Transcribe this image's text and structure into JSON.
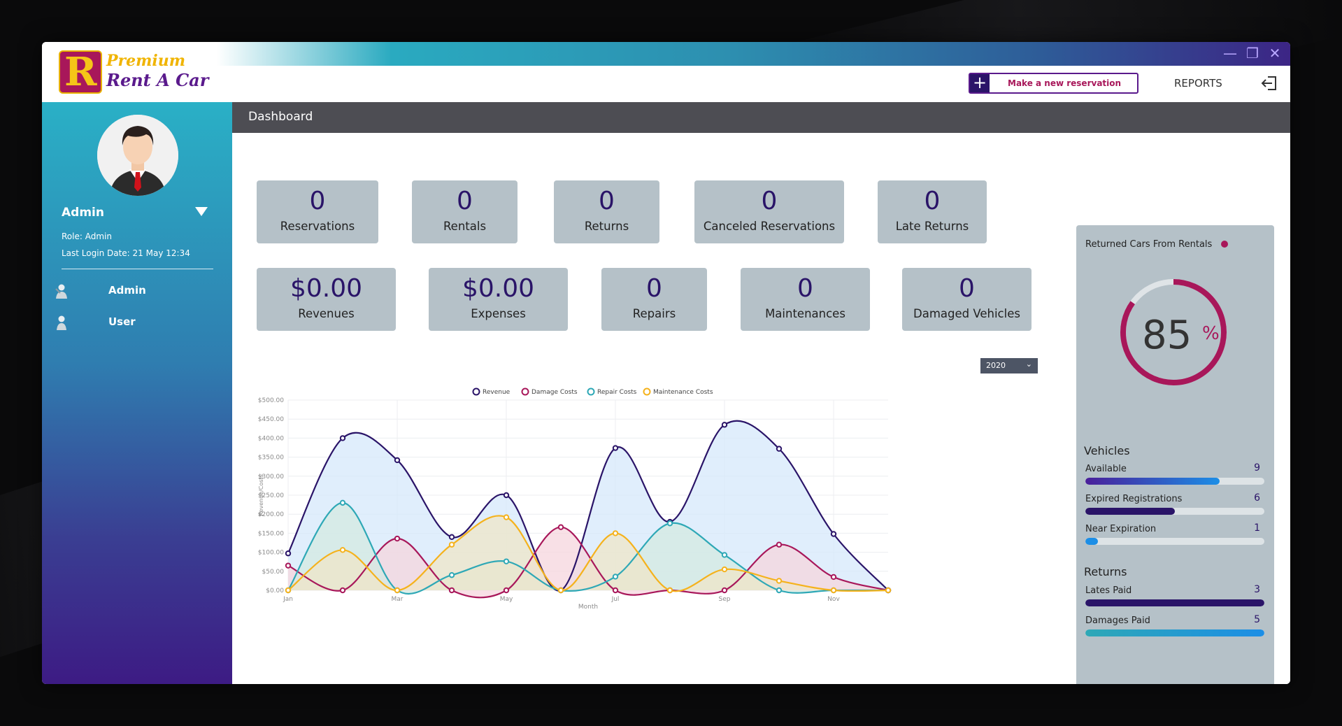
{
  "app": {
    "logo_line1": "Premium",
    "logo_line2": "Rent A Car",
    "logo_letter": "R",
    "new_reservation_label": "Make a new reservation",
    "reports_label": "REPORTS"
  },
  "window_controls": {
    "minimize": "—",
    "maximize": "❐",
    "close": "✕"
  },
  "sidebar": {
    "user_name": "Admin",
    "role": "Role: Admin",
    "last_login": "Last Login Date: 21 May 12:34",
    "items": [
      {
        "label": "Admin",
        "icon": "admin-user-icon"
      },
      {
        "label": "User",
        "icon": "user-icon"
      }
    ]
  },
  "header": {
    "title": "Dashboard"
  },
  "stats": {
    "row1": [
      {
        "value": "0",
        "label": "Reservations"
      },
      {
        "value": "0",
        "label": "Rentals"
      },
      {
        "value": "0",
        "label": "Returns"
      },
      {
        "value": "0",
        "label": "Canceled Reservations"
      },
      {
        "value": "0",
        "label": "Late Returns"
      }
    ],
    "row2": [
      {
        "value": "$0.00",
        "label": "Revenues"
      },
      {
        "value": "$0.00",
        "label": "Expenses"
      },
      {
        "value": "0",
        "label": "Repairs"
      },
      {
        "value": "0",
        "label": "Maintenances"
      },
      {
        "value": "0",
        "label": "Damaged Vehicles"
      }
    ]
  },
  "year_select": {
    "value": "2020"
  },
  "chart_data": {
    "type": "area",
    "x": [
      "Jan",
      "Feb",
      "Mar",
      "Apr",
      "May",
      "Jun",
      "Jul",
      "Aug",
      "Sep",
      "Oct",
      "Nov",
      "Dec"
    ],
    "x_tick_labels": [
      "Jan",
      "Mar",
      "May",
      "Jul",
      "Sep",
      "Nov"
    ],
    "y_tick_labels": [
      "$0.00",
      "$50.00",
      "$100.00",
      "$150.00",
      "$200.00",
      "$250.00",
      "$300.00",
      "$350.00",
      "$400.00",
      "$450.00",
      "$500.00"
    ],
    "xlabel": "Month",
    "ylabel": "Revenue/Costs",
    "ylim": [
      0,
      500
    ],
    "legend_position": "top",
    "grid": true,
    "smooth": true,
    "series": [
      {
        "name": "Revenue",
        "color": "#2a1468",
        "fill": "#d6e8fb",
        "values": [
          97,
          400,
          342,
          140,
          250,
          0,
          374,
          180,
          435,
          372,
          148,
          0
        ]
      },
      {
        "name": "Damage Costs",
        "color": "#a8175a",
        "fill": "#f5d5de",
        "values": [
          65,
          0,
          136,
          0,
          0,
          166,
          0,
          0,
          0,
          120,
          35,
          0
        ]
      },
      {
        "name": "Repair Costs",
        "color": "#2ea8b6",
        "fill": "#d4e9e2",
        "values": [
          0,
          230,
          0,
          40,
          76,
          0,
          36,
          176,
          93,
          0,
          0,
          0
        ]
      },
      {
        "name": "Maintenance Costs",
        "color": "#f5b21c",
        "fill": "#efe5c8",
        "values": [
          0,
          106,
          0,
          120,
          192,
          0,
          150,
          0,
          55,
          25,
          0,
          0
        ]
      }
    ]
  },
  "panel": {
    "title": "Returned Cars From Rentals",
    "gauge_value": "85",
    "gauge_fraction": 0.85,
    "gauge_unit": "%",
    "vehicles_title": "Vehicles",
    "vehicles": [
      {
        "label": "Available",
        "value": "9",
        "fraction": 0.75,
        "colors": [
          "#4a1f9a",
          "#1c8ee6"
        ]
      },
      {
        "label": "Expired Registrations",
        "value": "6",
        "fraction": 0.5,
        "colors": [
          "#2a1468",
          "#2a1468"
        ]
      },
      {
        "label": "Near Expiration",
        "value": "1",
        "fraction": 0.07,
        "colors": [
          "#1c8ee6",
          "#1c8ee6"
        ]
      }
    ],
    "returns_title": "Returns",
    "returns": [
      {
        "label": "Lates Paid",
        "value": "3",
        "fraction": 1.0,
        "colors": [
          "#2a1468",
          "#2a1468"
        ]
      },
      {
        "label": "Damages Paid",
        "value": "5",
        "fraction": 1.0,
        "colors": [
          "#2ea8b6",
          "#1c8ee6"
        ]
      }
    ]
  },
  "colors": {
    "accent_purple": "#2a1468",
    "accent_crimson": "#a8175a",
    "card_gray": "#b5c1c8",
    "header_gray": "#4d4d53"
  }
}
